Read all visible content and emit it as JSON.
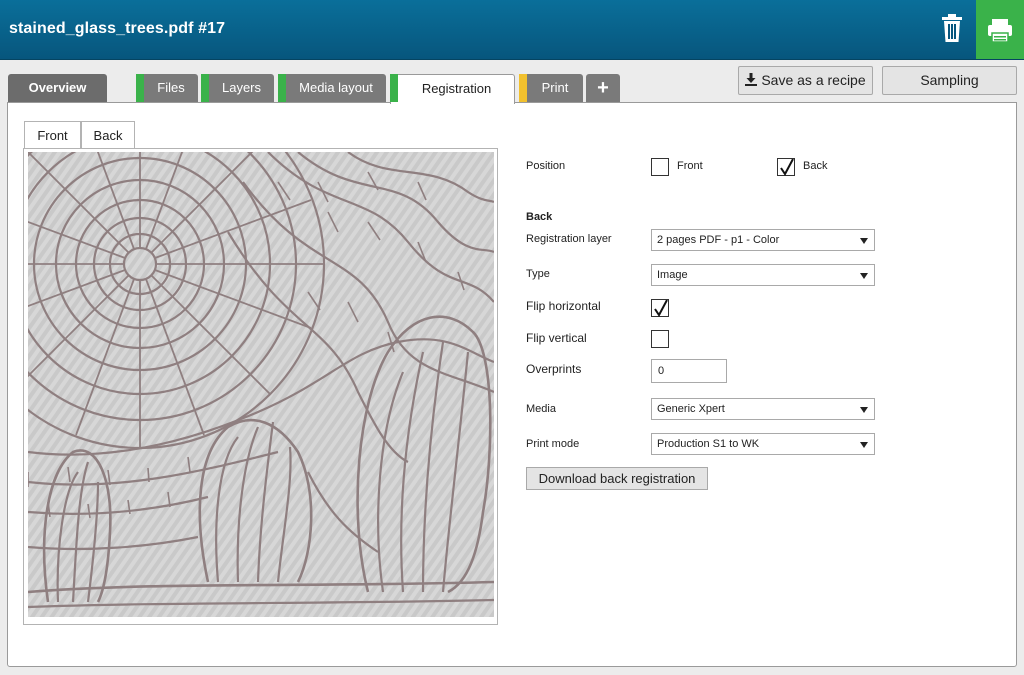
{
  "header": {
    "title": "stained_glass_trees.pdf #17",
    "trash_icon": "trash-icon",
    "print_icon": "printer-icon",
    "print_button_color": "#3ab24a"
  },
  "tabs": [
    {
      "label": "Overview",
      "status_color": null,
      "active": false
    },
    {
      "label": "Files",
      "status_color": "#3ab24a",
      "active": false
    },
    {
      "label": "Layers",
      "status_color": "#3ab24a",
      "active": false
    },
    {
      "label": "Media layout",
      "status_color": "#3ab24a",
      "active": false
    },
    {
      "label": "Registration",
      "status_color": "#3ab24a",
      "active": true
    },
    {
      "label": "Print",
      "status_color": "#f2c12e",
      "active": false
    },
    {
      "label": "+",
      "status_color": null,
      "active": false
    }
  ],
  "toolbar": {
    "save_recipe_label": "Save as a recipe",
    "save_recipe_icon": "download-icon",
    "sampling_label": "Sampling"
  },
  "side_tabs": {
    "front": "Front",
    "back": "Back"
  },
  "preview": {
    "image_desc_icon": "stained-glass-trees-preview"
  },
  "form": {
    "position_label": "Position",
    "position_front_label": "Front",
    "position_front_checked": false,
    "position_back_label": "Back",
    "position_back_checked": true,
    "section_title": "Back",
    "registration_layer_label": "Registration layer",
    "registration_layer_value": "2 pages PDF - p1 - Color",
    "type_label": "Type",
    "type_value": "Image",
    "flip_horizontal_label": "Flip horizontal",
    "flip_horizontal_checked": true,
    "flip_vertical_label": "Flip vertical",
    "flip_vertical_checked": false,
    "overprints_label": "Overprints",
    "overprints_value": "0",
    "media_label": "Media",
    "media_value": "Generic Xpert",
    "print_mode_label": "Print mode",
    "print_mode_value": "Production S1 to WK",
    "download_label": "Download back registration"
  }
}
